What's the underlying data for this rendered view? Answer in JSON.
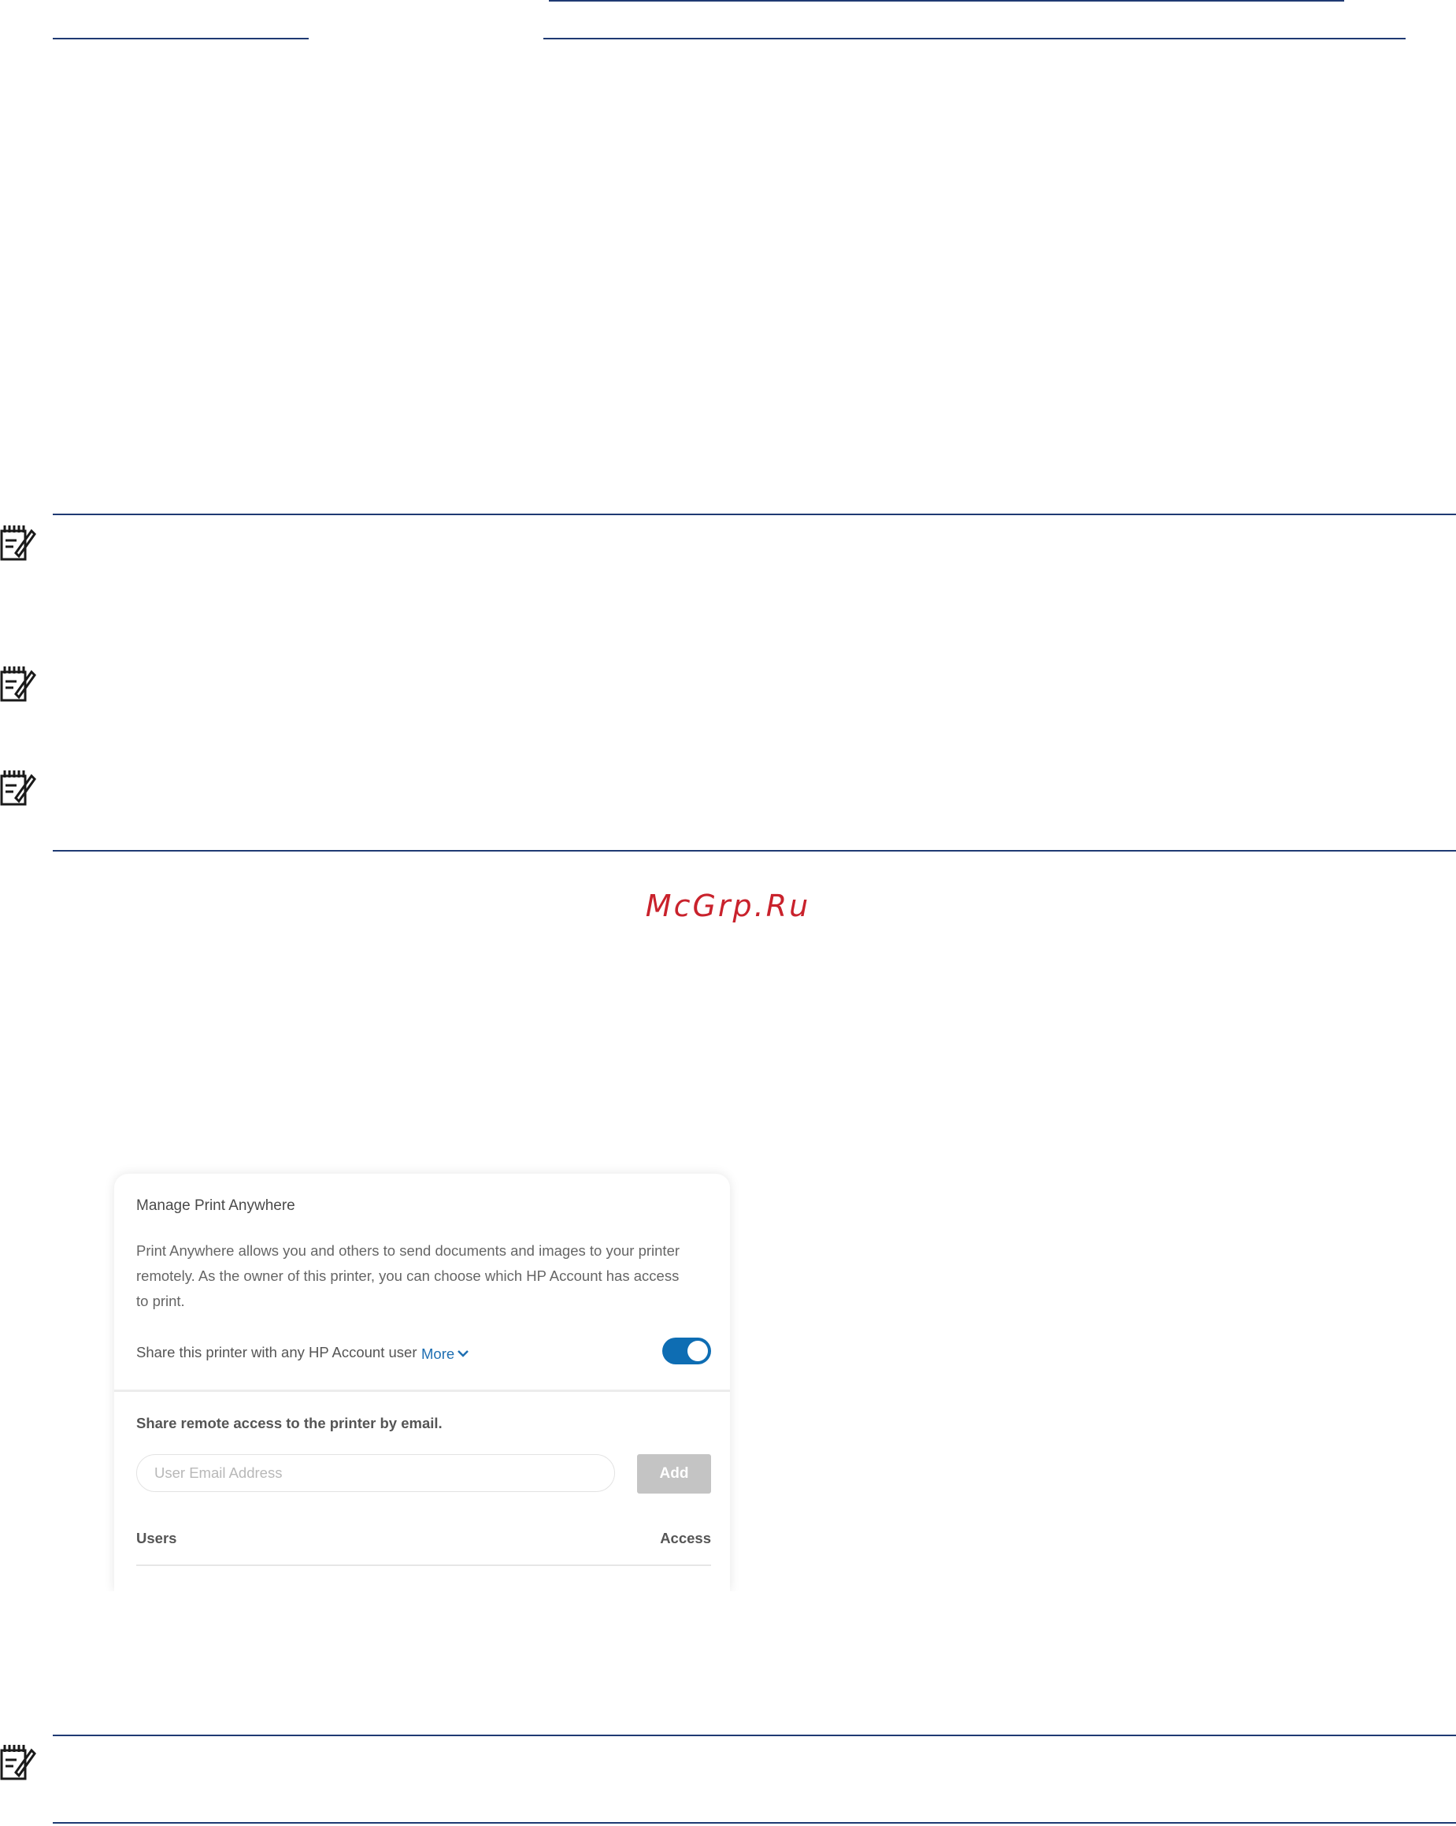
{
  "watermark": "McGrp.Ru",
  "card": {
    "title": "Manage Print Anywhere",
    "description": "Print Anywhere allows you and others to send documents and images to your printer remotely. As the owner of this printer, you can choose which HP Account has access to print.",
    "share_label": "Share this printer with any HP Account user",
    "more_label": "More",
    "toggle_on": true,
    "email_heading": "Share remote access to the printer by email.",
    "email_placeholder": "User Email Address",
    "email_value": "",
    "add_label": "Add",
    "table_headers": {
      "users": "Users",
      "access": "Access"
    }
  },
  "colors": {
    "rule": "#1f3a73",
    "watermark": "#c9222c",
    "toggle": "#0e6db3",
    "more_link": "#1f6fb2",
    "add_button_disabled": "#c4c4c4"
  },
  "icons": [
    "note-icon",
    "chevron-down-icon"
  ]
}
